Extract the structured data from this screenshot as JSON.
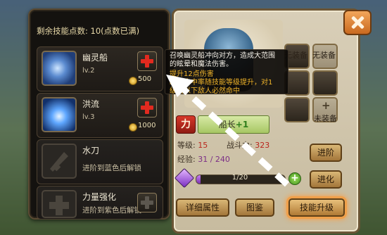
{
  "skills_panel": {
    "points_label": "剩余技能点数:",
    "points_value": "10(点数已满)",
    "skills": [
      {
        "name": "幽灵船",
        "level": "lv.2",
        "cost": "500",
        "state": "learned"
      },
      {
        "name": "洪流",
        "level": "lv.3",
        "cost": "1000",
        "state": "learned"
      },
      {
        "name": "水刀",
        "unlock_text": "进阶到蓝色后解锁",
        "state": "locked"
      },
      {
        "name": "力量强化",
        "unlock_text": "进阶到紫色后解锁",
        "state": "locked"
      }
    ]
  },
  "tooltip": {
    "desc_line1": "召唤幽灵船冲向对方，造成大范围",
    "desc_line2": "的眩晕和魔法伤害。",
    "upgrade_line1": "提升12点伤害",
    "upgrade_line2": "眩晕命中率随技能等级提升，对1",
    "upgrade_line3": "级或以下敌人必然命中"
  },
  "hero": {
    "class_badge": "力",
    "name": "船长",
    "name_suffix": "+1",
    "level_label": "等级:",
    "level_value": "15",
    "power_label": "战斗力:",
    "power_value": "323",
    "exp_label": "经验:",
    "exp_value": "31 / 240",
    "evolve_progress_text": "1/20",
    "evolve_progress": 0.05,
    "equipment": [
      {
        "label": "无装备"
      },
      {
        "label": "无装备"
      },
      {
        "label": ""
      },
      {
        "label": ""
      },
      {
        "label": ""
      },
      {
        "label": "未装备"
      }
    ]
  },
  "buttons": {
    "advance": "进阶",
    "evolve": "进化",
    "details": "详细属性",
    "codex": "图鉴",
    "skill_upgrade": "技能升级"
  },
  "colors": {
    "accent_highlight": "#f0a04a",
    "add_button": "#e22a1f",
    "stat_value": "#b9261d"
  }
}
